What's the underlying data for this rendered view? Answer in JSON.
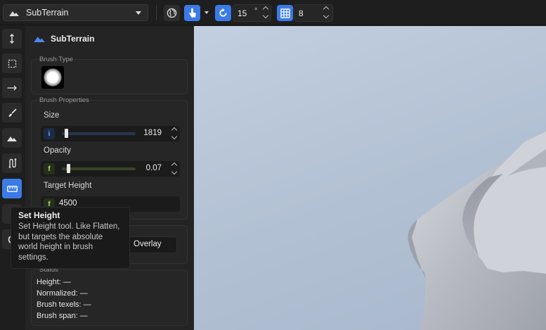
{
  "toolbar": {
    "terrain_name": "SubTerrain",
    "rotation_value": "15",
    "rotation_unit": "°",
    "grid_value": "8",
    "accent": "#3b7be8"
  },
  "left_tools": [
    {
      "name": "raise-lower-tool",
      "icon": "vertical-arrows-icon"
    },
    {
      "name": "selection-tool",
      "icon": "dashed-rect-icon"
    },
    {
      "name": "smooth-tool",
      "icon": "arrow-right-icon"
    },
    {
      "name": "paint-tool",
      "icon": "brush-icon"
    },
    {
      "name": "terrain-tool",
      "icon": "mountain-icon"
    },
    {
      "name": "ramp-tool",
      "icon": "path-icon"
    },
    {
      "name": "set-height-tool",
      "icon": "ruler-icon",
      "active": true
    }
  ],
  "panel": {
    "title": "SubTerrain",
    "brush_type_label": "Brush Type",
    "brush_props_label": "Brush Properties",
    "size_label": "Size",
    "size_type": "i",
    "size_value": "1819",
    "size_fraction": 0.04,
    "opacity_label": "Opacity",
    "opacity_type": "f",
    "opacity_value": "0.07",
    "opacity_fraction": 0.07,
    "target_height_label": "Target Height",
    "target_height_type": "f",
    "target_height_value": "4500",
    "overlay_label": "Overlay",
    "status_label": "Status",
    "status": {
      "height": "Height: —",
      "normalized": "Normalized: —",
      "brush_texels": "Brush texels: —",
      "brush_span": "Brush span: —"
    }
  },
  "tooltip": {
    "title": "Set Height",
    "body": "Set Height tool. Like Flatten, but targets the absolute world height in brush settings."
  }
}
